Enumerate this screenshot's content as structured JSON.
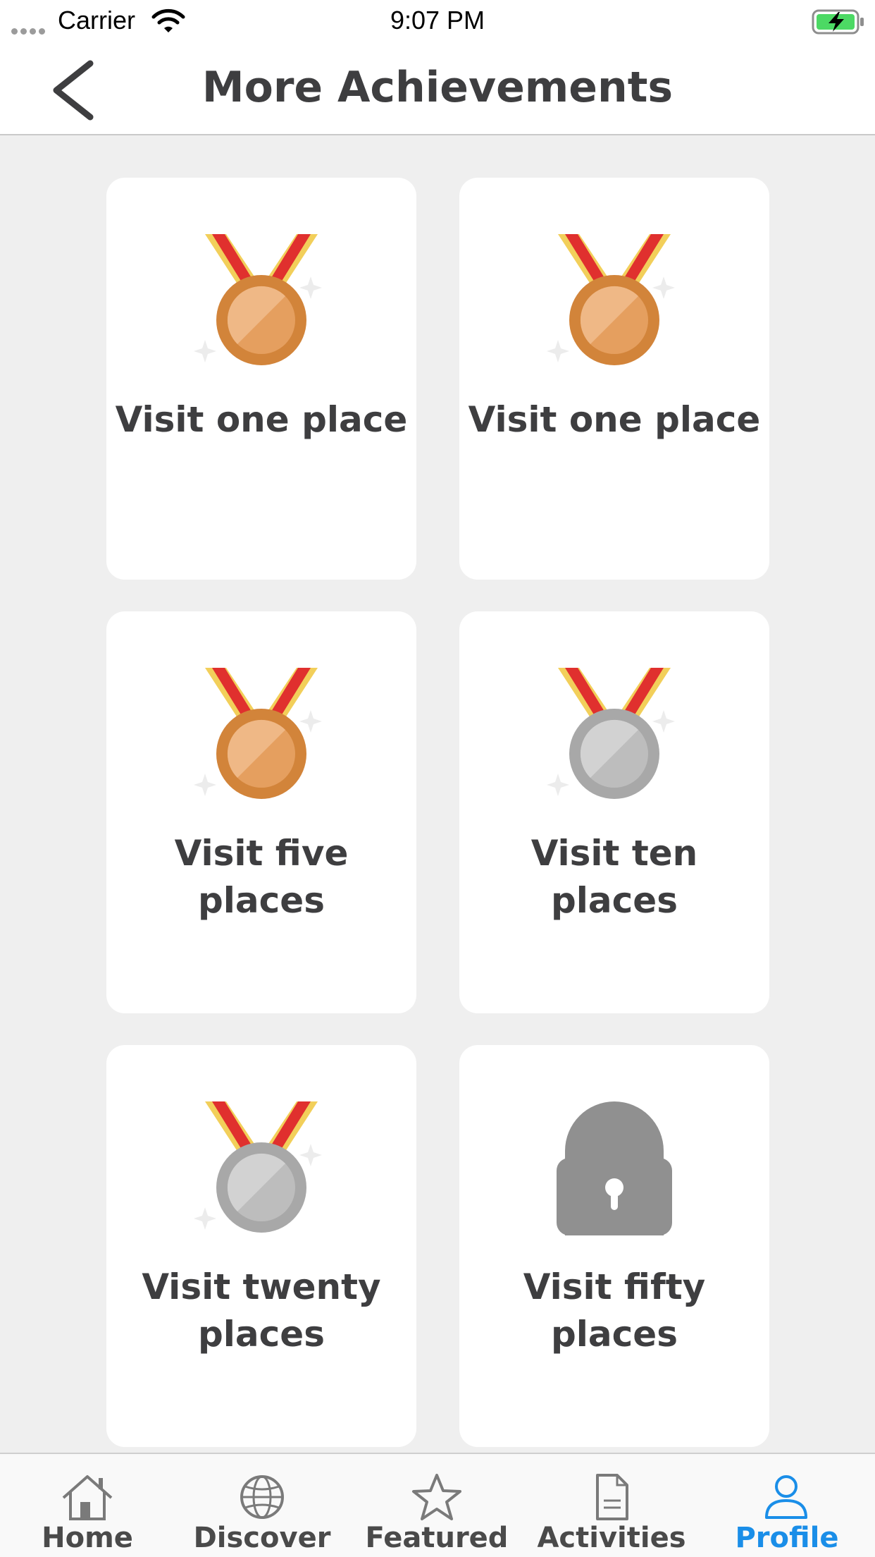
{
  "status_bar": {
    "carrier": "Carrier",
    "time": "9:07 PM"
  },
  "header": {
    "title": "More Achievements",
    "back_icon": "chevron-left-icon"
  },
  "achievements": [
    {
      "label": "Visit one place",
      "icon": "bronze-medal-icon",
      "status": "bronze"
    },
    {
      "label": "Visit one place",
      "icon": "bronze-medal-icon",
      "status": "bronze"
    },
    {
      "label": "Visit five places",
      "icon": "bronze-medal-icon",
      "status": "bronze"
    },
    {
      "label": "Visit ten places",
      "icon": "silver-medal-icon",
      "status": "silver"
    },
    {
      "label": "Visit twenty places",
      "icon": "silver-medal-icon",
      "status": "silver"
    },
    {
      "label": "Visit fifty places",
      "icon": "lock-icon",
      "status": "locked"
    }
  ],
  "tabs": [
    {
      "label": "Home",
      "icon": "home-icon",
      "active": false
    },
    {
      "label": "Discover",
      "icon": "globe-icon",
      "active": false
    },
    {
      "label": "Featured",
      "icon": "star-icon",
      "active": false
    },
    {
      "label": "Activities",
      "icon": "document-icon",
      "active": false
    },
    {
      "label": "Profile",
      "icon": "user-icon",
      "active": true
    }
  ],
  "colors": {
    "accent": "#1a8ee8",
    "text": "#3e3e40",
    "background": "#efefef",
    "card": "#ffffff"
  }
}
